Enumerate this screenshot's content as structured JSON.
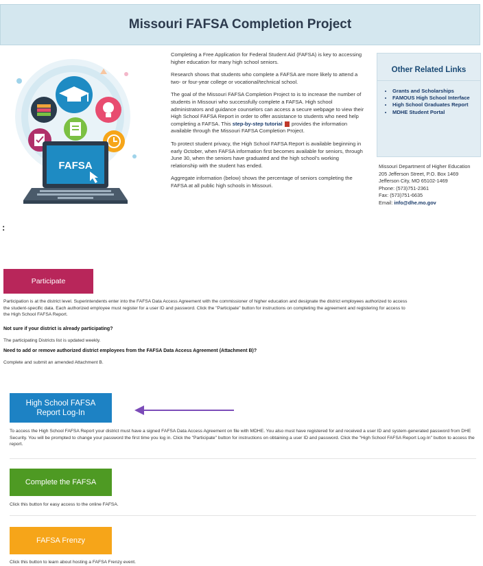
{
  "header": {
    "title": "Missouri FAFSA Completion Project"
  },
  "illustration": {
    "screen_text": "FAFSA"
  },
  "intro": {
    "p1": "Completing a Free Application for Federal Student Aid (FAFSA) is key to accessing higher education for many high school seniors.",
    "p2": "Research shows that students who complete a FAFSA are more likely to attend a two- or four-year college or vocational/technical school.",
    "p3_before": "The goal of the Missouri FAFSA Completion Project to is to increase the number of students in Missouri who successfully complete a FAFSA. High school administrators and guidance counselors can access a secure webpage to view their High School FAFSA Report in order to offer assistance to students who need help completing a FAFSA. This ",
    "p3_link": "step-by-step tutorial",
    "p3_after": " provides the information available through the Missouri FAFSA Completion Project.",
    "p4": "To protect student privacy, the High School FAFSA Report is available beginning in early October, when FAFSA information first becomes available for seniors, through June 30, when the seniors have graduated and the high school's working relationship with the student has ended.",
    "p5": "Aggregate information (below) shows the percentage of seniors completing the FAFSA at all public high schools in Missouri."
  },
  "colon": ":",
  "related": {
    "title": "Other Related Links",
    "links": [
      "Grants and Scholarships",
      "FAMOUS High School Interface",
      "High School Graduates Report",
      "MDHE Student Portal"
    ]
  },
  "contact": {
    "org": "Missouri Department of Higher Education",
    "street": "205 Jefferson Street, P.O. Box 1469",
    "city": "Jefferson City, MO 65102-1469",
    "phone": "Phone: (573)751-2361",
    "fax": "Fax: (573)751-6635",
    "email_label": "Email: ",
    "email": "info@dhe.mo.gov"
  },
  "participate": {
    "button": "Participate",
    "desc": "Participation is at the district level. Superintendents enter into the FAFSA Data Access Agreement with the commissioner of higher education and designate the district employees authorized to access the student-specific data. Each authorized employee must register for a user ID and password. Click the \"Participate\" button for instructions on completing the agreement and registering for access to the High School FAFSA Report.",
    "q1": "Not sure if your district is already participating?",
    "a1": "The participating Districts list is updated weekly.",
    "q2": "Need to add or remove authorized district employees from the FAFSA Data Access Agreement (Attachment B)?",
    "a2": "Complete and submit an amended Attachment B."
  },
  "hs_login": {
    "button_line1": "High School FAFSA",
    "button_line2": "Report Log-In",
    "desc": "To access the High School FAFSA Report your district must have a signed FAFSA Data Access Agreement on file with MDHE. You also must have registered for and received a user ID and system-generated password from DHE Security. You will be prompted to change your password the first time you log in. Click the \"Participate\" button for instructions on obtaining a user ID and password. Click the \"High School FAFSA Report Log-In\" button to access the report."
  },
  "complete": {
    "button": "Complete the FAFSA",
    "desc": "Click this button for easy access to the online FAFSA."
  },
  "frenzy": {
    "button": "FAFSA Frenzy",
    "desc": "Click this button to learn about hosting a FAFSA Frenzy event."
  },
  "colors": {
    "header_bg": "#d4e7ef",
    "participate": "#b8265a",
    "hs_login": "#1d82c4",
    "complete": "#4e9a23",
    "frenzy": "#f6a519",
    "arrow": "#7b4bb8"
  }
}
